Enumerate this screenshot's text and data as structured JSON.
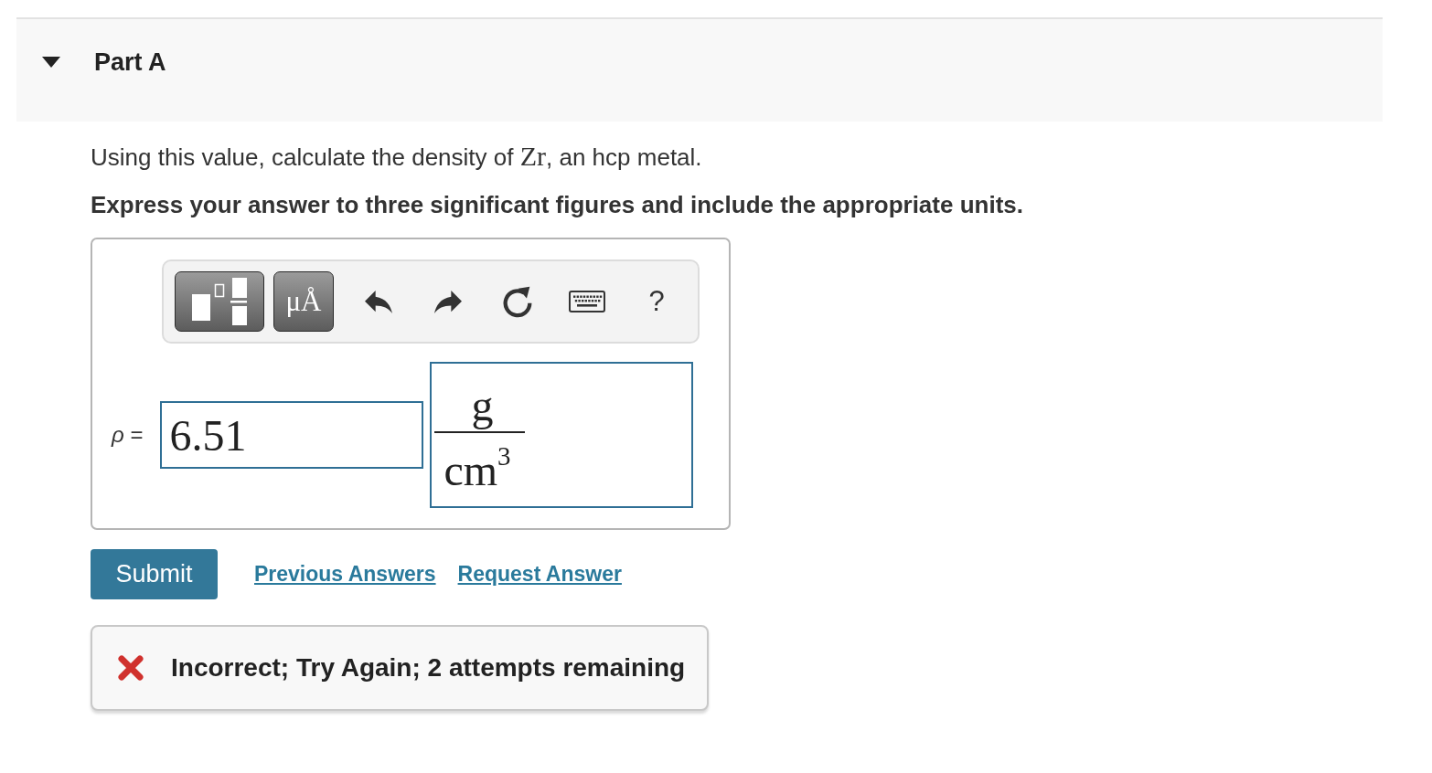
{
  "part": {
    "title": "Part A",
    "expanded": true
  },
  "question": {
    "segments": [
      {
        "kind": "text",
        "text": "Using this value, calculate the density of "
      },
      {
        "kind": "math",
        "text": "Zr"
      },
      {
        "kind": "text",
        "text": ", an hcp metal."
      }
    ]
  },
  "instruction": "Express your answer to three significant figures and include the appropriate units.",
  "toolbar": [
    {
      "kind": "templates"
    },
    {
      "kind": "symbols",
      "label": "μÅ"
    },
    {
      "kind": "undo"
    },
    {
      "kind": "redo"
    },
    {
      "kind": "reset"
    },
    {
      "kind": "keyboard"
    },
    {
      "kind": "help",
      "label": "?"
    }
  ],
  "answer": {
    "label": "*ρ* =",
    "value": "6.51",
    "units": {
      "numerator": "g",
      "denominator": "cm$^{3}$"
    }
  },
  "actions": {
    "submit": "Submit",
    "previous_answers": "Previous Answers",
    "request_answer": "Request Answer"
  },
  "feedback": {
    "kind": "incorrect",
    "text": "Incorrect; Try Again; 2 attempts remaining"
  }
}
